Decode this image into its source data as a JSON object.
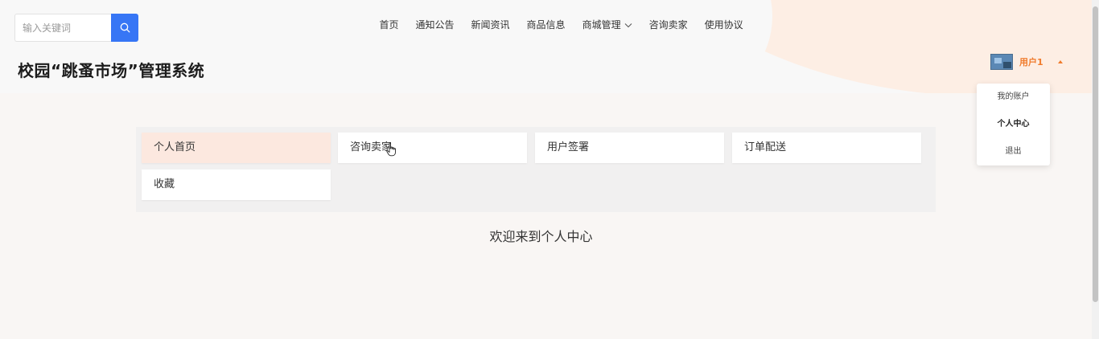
{
  "search": {
    "placeholder": "输入关键词",
    "icon": "search-icon"
  },
  "nav": {
    "items": [
      {
        "label": "首页"
      },
      {
        "label": "通知公告"
      },
      {
        "label": "新闻资讯"
      },
      {
        "label": "商品信息"
      },
      {
        "label": "商城管理",
        "has_dropdown": true
      },
      {
        "label": "咨询卖家"
      },
      {
        "label": "使用协议"
      }
    ]
  },
  "site": {
    "title": "校园“跳蚤市场”管理系统"
  },
  "user": {
    "name": "用户1",
    "menu": [
      {
        "label": "我的账户"
      },
      {
        "label": "个人中心",
        "active": true
      },
      {
        "label": "退出"
      }
    ]
  },
  "center": {
    "tiles": [
      {
        "label": "个人首页",
        "active": true
      },
      {
        "label": "咨询卖家"
      },
      {
        "label": "用户签署"
      },
      {
        "label": "订单配送"
      },
      {
        "label": "收藏"
      }
    ],
    "welcome": "欢迎来到个人中心"
  },
  "colors": {
    "accent": "#3776f5",
    "brand_orange": "#f07b2c",
    "active_tile": "#fce8df"
  }
}
